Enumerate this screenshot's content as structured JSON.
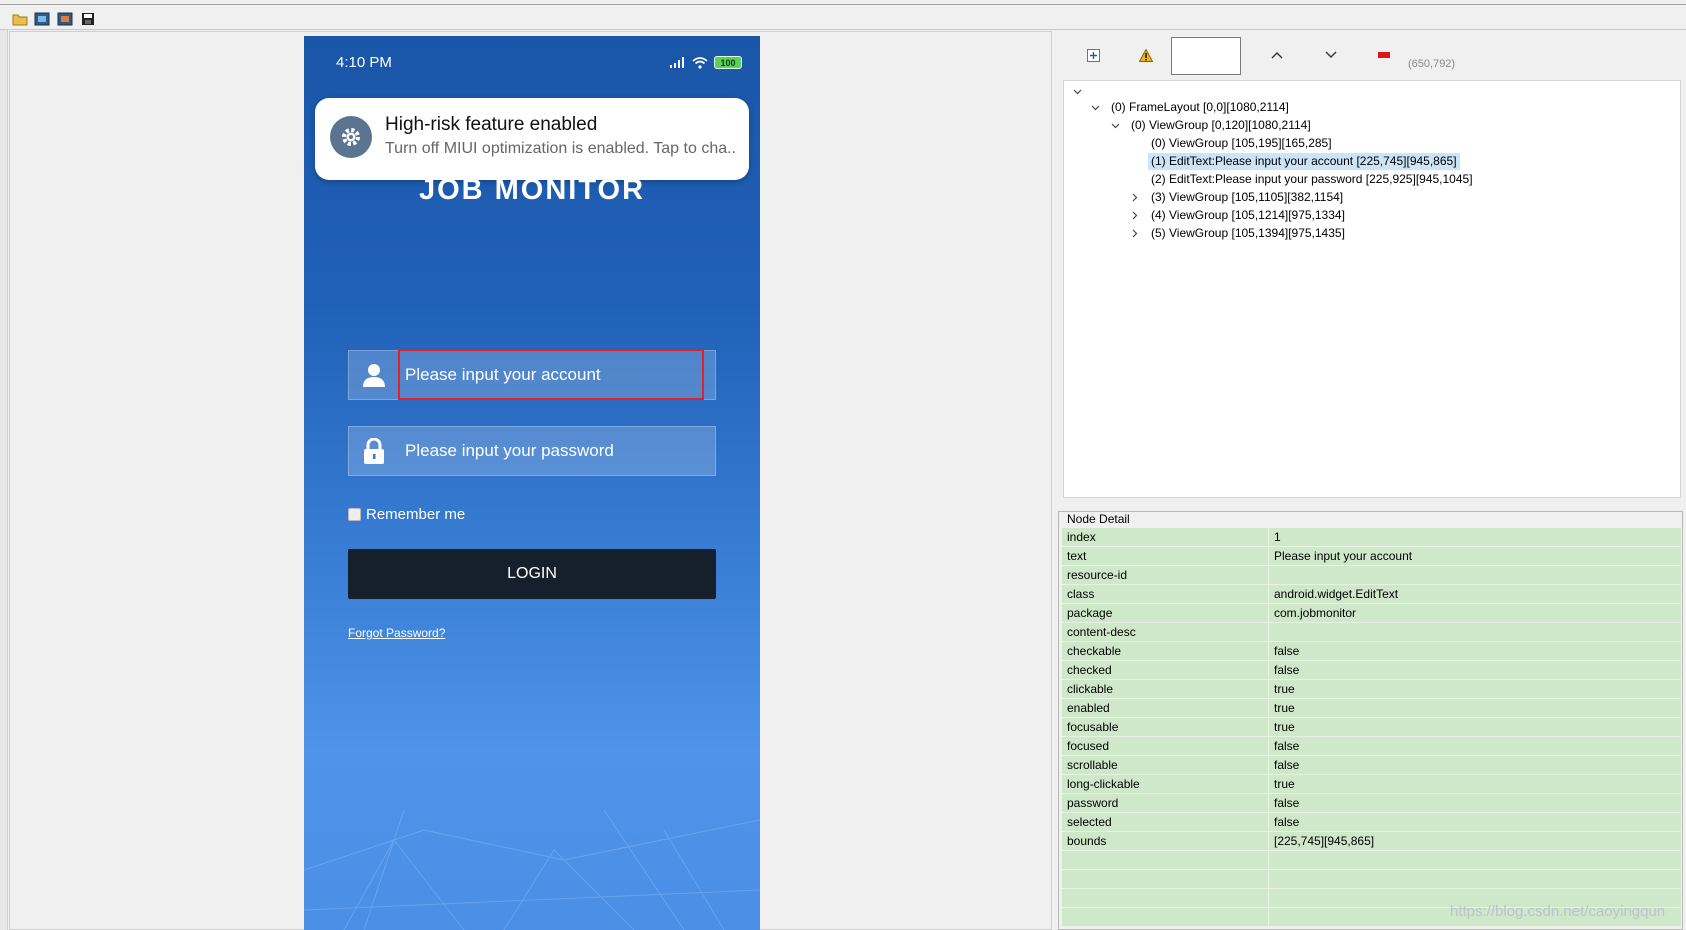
{
  "toolbar": {
    "buttons": [
      "open-icon",
      "screenshot-icon",
      "screenshot-compressed-icon",
      "save-icon"
    ]
  },
  "phone": {
    "status_time": "4:10 PM",
    "battery": "100",
    "notification": {
      "title": "High-risk feature enabled",
      "body": "Turn off MIUI optimization is enabled. Tap to cha.."
    },
    "app_logo": "JOB MONITOR",
    "account_placeholder": "Please input your account",
    "password_placeholder": "Please input your password",
    "remember_label": "Remember me",
    "login_label": "LOGIN",
    "forgot_label": "Forgot Password?"
  },
  "inspector": {
    "coords": "(650,792)",
    "tree": [
      {
        "label": "(0) FrameLayout [0,0][1080,2114]",
        "expanded": true
      },
      {
        "label": "(0) ViewGroup [0,120][1080,2114]",
        "expanded": true
      },
      {
        "label": "(0) ViewGroup [105,195][165,285]"
      },
      {
        "label": "(1) EditText:Please input your account [225,745][945,865]",
        "selected": true
      },
      {
        "label": "(2) EditText:Please input your password [225,925][945,1045]"
      },
      {
        "label": "(3) ViewGroup [105,1105][382,1154]",
        "collapsed": true
      },
      {
        "label": "(4) ViewGroup [105,1214][975,1334]",
        "collapsed": true
      },
      {
        "label": "(5) ViewGroup [105,1394][975,1435]",
        "collapsed": true
      }
    ],
    "detail_title": "Node Detail",
    "details": [
      {
        "key": "index",
        "value": "1"
      },
      {
        "key": "text",
        "value": "Please input your account"
      },
      {
        "key": "resource-id",
        "value": ""
      },
      {
        "key": "class",
        "value": "android.widget.EditText"
      },
      {
        "key": "package",
        "value": "com.jobmonitor"
      },
      {
        "key": "content-desc",
        "value": ""
      },
      {
        "key": "checkable",
        "value": "false"
      },
      {
        "key": "checked",
        "value": "false"
      },
      {
        "key": "clickable",
        "value": "true"
      },
      {
        "key": "enabled",
        "value": "true"
      },
      {
        "key": "focusable",
        "value": "true"
      },
      {
        "key": "focused",
        "value": "false"
      },
      {
        "key": "scrollable",
        "value": "false"
      },
      {
        "key": "long-clickable",
        "value": "true"
      },
      {
        "key": "password",
        "value": "false"
      },
      {
        "key": "selected",
        "value": "false"
      },
      {
        "key": "bounds",
        "value": "[225,745][945,865]"
      }
    ],
    "watermark": "https://blog.csdn.net/caoyingqun"
  },
  "colors": {
    "accent_highlight": "#e0202a",
    "detail_row": "#cfe8c9",
    "tree_selection": "#cce4f7"
  }
}
